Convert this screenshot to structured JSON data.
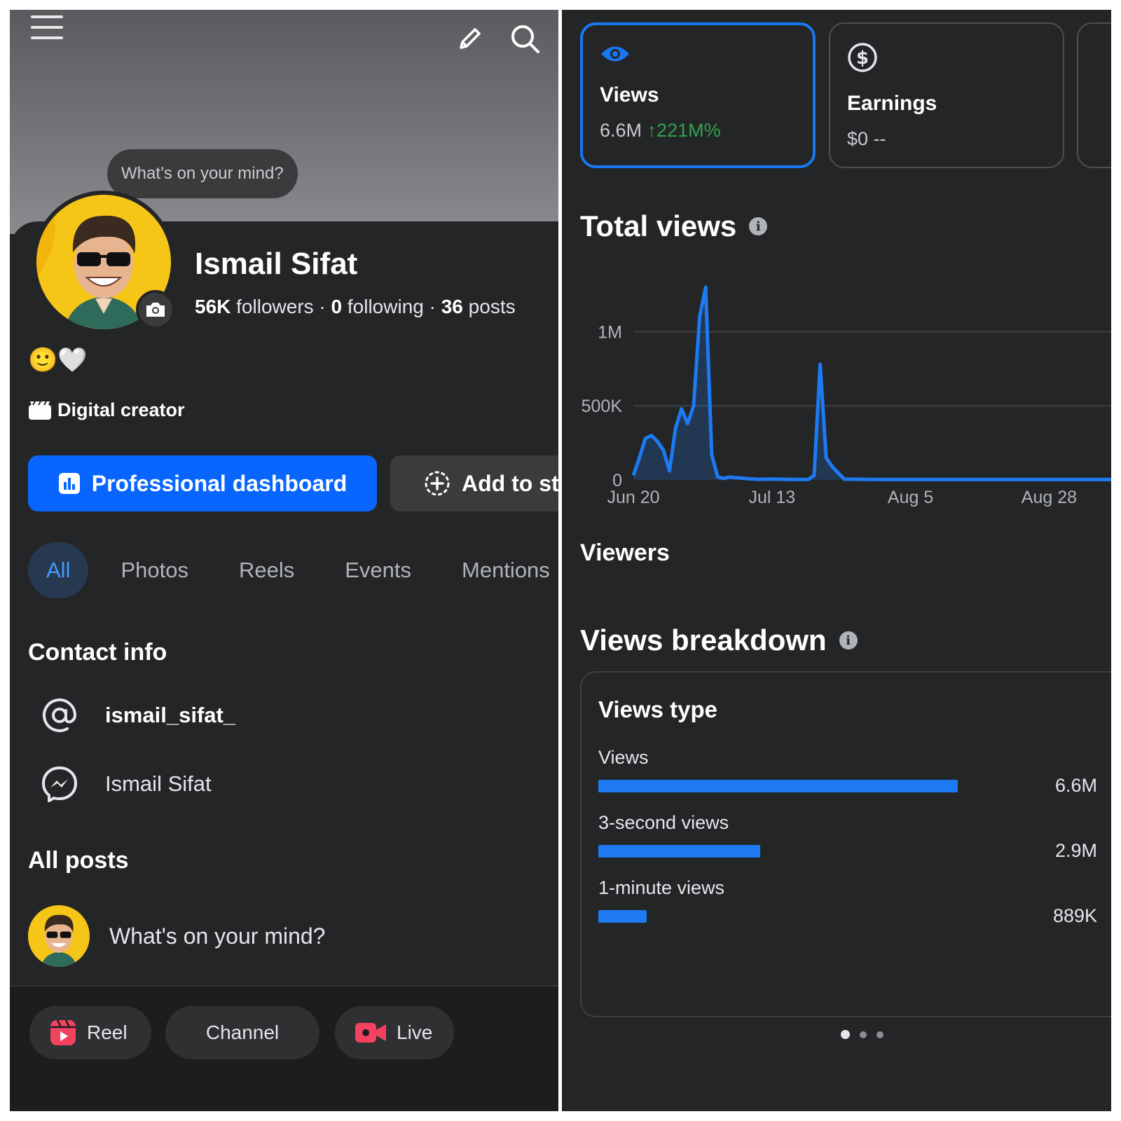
{
  "profile": {
    "mind_prompt": "What’s on your mind?",
    "name": "Ismail Sifat",
    "followers_count": "56K",
    "followers_label": "followers",
    "following_count": "0",
    "following_label": "following",
    "posts_count": "36",
    "posts_label": "posts",
    "separator": "·",
    "emojis": "🙂🤍",
    "category": "Digital creator"
  },
  "actions": {
    "dashboard_label": "Professional dashboard",
    "story_label": "Add to story"
  },
  "tabs": [
    {
      "label": "All",
      "active": true
    },
    {
      "label": "Photos"
    },
    {
      "label": "Reels"
    },
    {
      "label": "Events"
    },
    {
      "label": "Mentions"
    }
  ],
  "contact": {
    "title": "Contact info",
    "instagram": "ismail_sifat_",
    "messenger": "Ismail Sifat"
  },
  "posts": {
    "title": "All posts",
    "composer_prompt": "What's on your mind?"
  },
  "bottom_bar": {
    "reel": "Reel",
    "channel": "Channel",
    "live": "Live"
  },
  "metrics": [
    {
      "label": "Views",
      "value": "6.6M",
      "change": "221M%",
      "active": true
    },
    {
      "label": "Earnings",
      "value": "$0",
      "change": "--"
    }
  ],
  "sections": {
    "total_views": "Total views",
    "viewers": "Viewers",
    "views_breakdown": "Views breakdown",
    "info_glyph": "i"
  },
  "colors": {
    "accent": "#0866ff",
    "line": "#1d7af3",
    "positive": "#31a24c",
    "panel": "#242526"
  },
  "chart_data": {
    "type": "area",
    "title": "Total views",
    "y_ticks": [
      {
        "value": 0,
        "label": "0"
      },
      {
        "value": 500000,
        "label": "500K"
      },
      {
        "value": 1000000,
        "label": "1M"
      }
    ],
    "ylim": [
      0,
      1300000
    ],
    "x_ticks": [
      {
        "day": 0,
        "label": "Jun 20"
      },
      {
        "day": 23,
        "label": "Jul 13"
      },
      {
        "day": 46,
        "label": "Aug 5"
      },
      {
        "day": 69,
        "label": "Aug 28"
      }
    ],
    "xlim": [
      0,
      80
    ],
    "points": [
      [
        0,
        30000
      ],
      [
        1,
        150000
      ],
      [
        2,
        280000
      ],
      [
        3,
        300000
      ],
      [
        4,
        260000
      ],
      [
        5,
        200000
      ],
      [
        6,
        60000
      ],
      [
        7,
        350000
      ],
      [
        8,
        480000
      ],
      [
        9,
        380000
      ],
      [
        10,
        500000
      ],
      [
        11,
        1100000
      ],
      [
        12,
        1300000
      ],
      [
        13,
        170000
      ],
      [
        14,
        20000
      ],
      [
        15,
        10000
      ],
      [
        16,
        20000
      ],
      [
        17,
        15000
      ],
      [
        19,
        8000
      ],
      [
        21,
        4000
      ],
      [
        23,
        6000
      ],
      [
        26,
        4000
      ],
      [
        29,
        3000
      ],
      [
        30,
        30000
      ],
      [
        31,
        780000
      ],
      [
        32,
        150000
      ],
      [
        33,
        90000
      ],
      [
        35,
        5000
      ],
      [
        40,
        3000
      ],
      [
        50,
        3000
      ],
      [
        60,
        3000
      ],
      [
        70,
        3000
      ],
      [
        80,
        3000
      ]
    ]
  },
  "views_type": {
    "title": "Views type",
    "rows": [
      {
        "label": "Views",
        "value": "6.6M",
        "fraction": 1.0
      },
      {
        "label": "3-second views",
        "value": "2.9M",
        "fraction": 0.45
      },
      {
        "label": "1-minute views",
        "value": "889K",
        "fraction": 0.135
      }
    ]
  }
}
